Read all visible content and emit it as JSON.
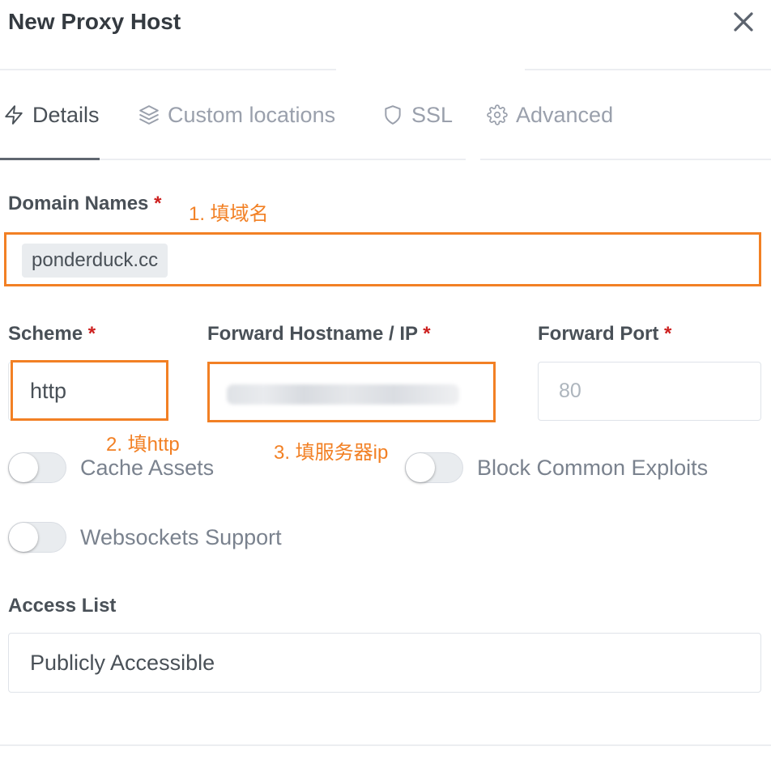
{
  "modal": {
    "title": "New Proxy Host",
    "close_icon": "close-icon"
  },
  "tabs": [
    {
      "label": "Details",
      "icon": "lightning-icon",
      "active": true
    },
    {
      "label": "Custom locations",
      "icon": "layers-icon",
      "active": false
    },
    {
      "label": "SSL",
      "icon": "shield-icon",
      "active": false
    },
    {
      "label": "Advanced",
      "icon": "gear-icon",
      "active": false
    }
  ],
  "form": {
    "domain_names": {
      "label": "Domain Names",
      "required_mark": "*",
      "tags": [
        "ponderduck.cc"
      ]
    },
    "scheme": {
      "label": "Scheme",
      "required_mark": "*",
      "value": "http"
    },
    "forward_hostname": {
      "label": "Forward Hostname / IP",
      "required_mark": "*"
    },
    "forward_port": {
      "label": "Forward Port",
      "required_mark": "*",
      "placeholder": "80"
    },
    "toggles": [
      {
        "label": "Cache Assets",
        "checked": false
      },
      {
        "label": "Block Common Exploits",
        "checked": false
      },
      {
        "label": "Websockets Support",
        "checked": false
      }
    ],
    "access_list": {
      "label": "Access List",
      "value": "Publicly Accessible"
    }
  },
  "annotations": [
    {
      "text": "1. 填域名"
    },
    {
      "text": "2. 填http"
    },
    {
      "text": "3. 填服务器ip"
    }
  ],
  "colors": {
    "annotation": "#f28024",
    "required": "#cd201f",
    "text": "#495057",
    "muted": "#9aa0ac",
    "title": "#343a40",
    "switch-text": "#7a828e"
  }
}
